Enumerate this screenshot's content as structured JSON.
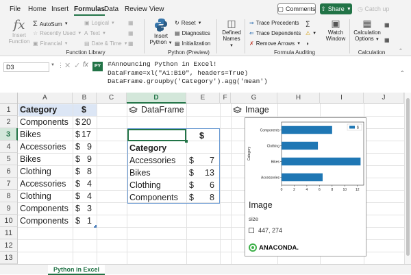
{
  "menu": {
    "tabs": [
      "File",
      "Home",
      "Insert",
      "Formulas",
      "Data",
      "Review",
      "View"
    ],
    "active": "Formulas",
    "comments": "Comments",
    "share": "Share",
    "catchup": "Catch up"
  },
  "ribbon": {
    "insert_function": [
      "Insert",
      "Function"
    ],
    "autosum": "AutoSum",
    "recently_used": "Recently Used",
    "financial": "Financial",
    "logical": "Logical",
    "text": "Text",
    "date_time": "Date & Time",
    "function_library": "Function Library",
    "insert_python": [
      "Insert",
      "Python"
    ],
    "reset": "Reset",
    "diagnostics": "Diagnostics",
    "initialization": "Initialization",
    "python_preview": "Python (Preview)",
    "defined_names": [
      "Defined",
      "Names"
    ],
    "trace_precedents": "Trace Precedents",
    "trace_dependents": "Trace Dependents",
    "remove_arrows": "Remove Arrows",
    "formula_auditing": "Formula Auditing",
    "watch_window": [
      "Watch",
      "Window"
    ],
    "calc_options": [
      "Calculation",
      "Options"
    ],
    "calculation": "Calculation"
  },
  "formula_bar": {
    "name_box": "D3",
    "py_badge": "PY",
    "code": [
      "#Announcing Python in Excel!",
      "DataFrame=xl(\"A1:B10\", headers=True)",
      "DataFrame.groupby('Category').agg('mean')"
    ]
  },
  "columns": [
    "A",
    "B",
    "C",
    "D",
    "E",
    "F",
    "G",
    "H",
    "I",
    "J"
  ],
  "rows": [
    "1",
    "2",
    "3",
    "4",
    "5",
    "6",
    "7",
    "8",
    "9",
    "10",
    "11",
    "12",
    "13"
  ],
  "sheet": {
    "a1": "Category",
    "b1": "$",
    "data": [
      {
        "cat": "Components",
        "cur": "$",
        "val": "20"
      },
      {
        "cat": "Bikes",
        "cur": "$",
        "val": "17"
      },
      {
        "cat": "Accessories",
        "cur": "$",
        "val": "9"
      },
      {
        "cat": "Bikes",
        "cur": "$",
        "val": "9"
      },
      {
        "cat": "Clothing",
        "cur": "$",
        "val": "8"
      },
      {
        "cat": "Accessories",
        "cur": "$",
        "val": "4"
      },
      {
        "cat": "Clothing",
        "cur": "$",
        "val": "4"
      },
      {
        "cat": "Components",
        "cur": "$",
        "val": "3"
      },
      {
        "cat": "Components",
        "cur": "$",
        "val": "1"
      }
    ]
  },
  "dataframe": {
    "label": "DataFrame",
    "header_dollar": "$",
    "index_name": "Category",
    "rows": [
      {
        "cat": "Accessories",
        "cur": "$",
        "val": "7"
      },
      {
        "cat": "Bikes",
        "cur": "$",
        "val": "13"
      },
      {
        "cat": "Clothing",
        "cur": "$",
        "val": "6"
      },
      {
        "cat": "Components",
        "cur": "$",
        "val": "8"
      }
    ]
  },
  "image_panel": {
    "label": "Image",
    "title": "Image",
    "size_label": "size",
    "size_value": "447, 274",
    "brand": "ANACONDA."
  },
  "chart_data": {
    "type": "bar",
    "orientation": "horizontal",
    "categories": [
      "Components",
      "Clothing",
      "Bikes",
      "Accessories"
    ],
    "values": [
      8,
      5.75,
      12.5,
      6.5
    ],
    "series": [
      {
        "name": "$",
        "values": [
          8,
          5.75,
          12.5,
          6.5
        ]
      }
    ],
    "ylabel": "Category",
    "xlabel": "",
    "xlim": [
      0,
      13
    ],
    "xticks": [
      "0",
      "2",
      "4",
      "6",
      "8",
      "10",
      "12"
    ],
    "legend": "top-right",
    "bar_color": "#1f77b4",
    "grid": false
  },
  "sheet_tab": "Python in Excel"
}
